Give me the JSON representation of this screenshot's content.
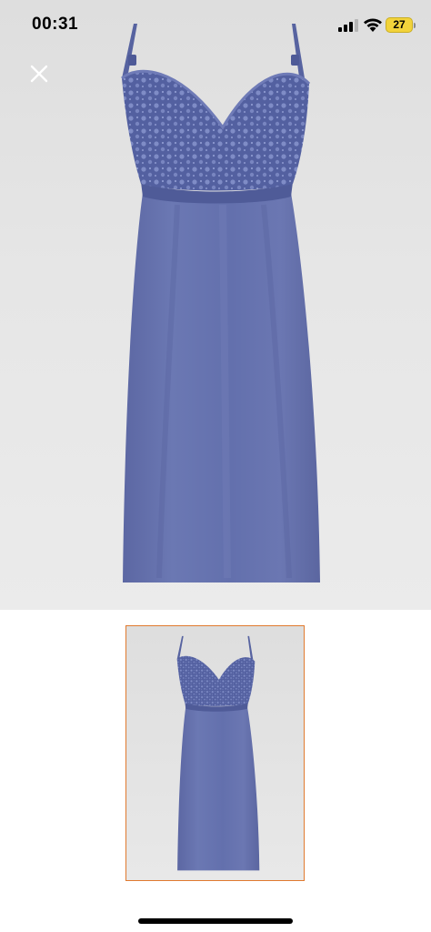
{
  "status_bar": {
    "time": "00:31",
    "battery_level": "27",
    "icons": [
      "signal-icon",
      "wifi-icon",
      "battery-icon"
    ]
  },
  "toolbar": {
    "close_icon": "close-icon"
  },
  "gallery": {
    "main_image": "product-image-nightdress",
    "thumbnails": [
      {
        "image": "thumbnail-nightdress",
        "selected": true
      }
    ]
  },
  "colors": {
    "thumbnail_selected_border": "#e07a2f",
    "background": "#ffffff",
    "product_color": "#6572ad"
  }
}
